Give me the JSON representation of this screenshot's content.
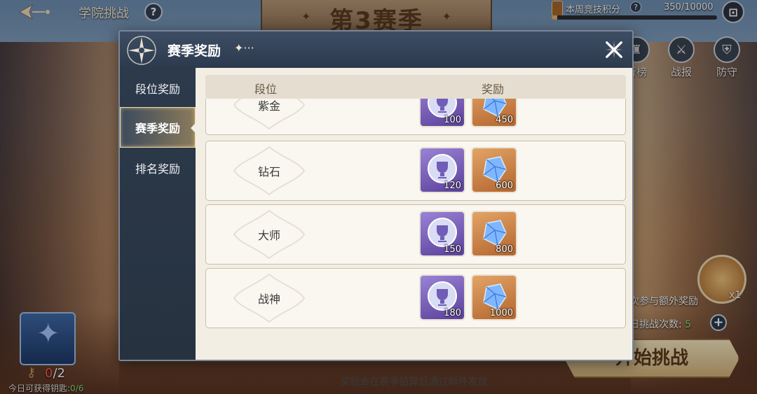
{
  "header": {
    "title": "学院挑战",
    "help": "?",
    "season_banner": "第3赛季",
    "weekly_points_label": "本周竞技积分",
    "weekly_points_help": "?",
    "weekly_points_value": "350/10000",
    "weekly_points_progress": 0.035,
    "gift_icon": "gift-box-icon"
  },
  "side_buttons": [
    {
      "label": "行榜",
      "icon": "leaderboard-icon"
    },
    {
      "label": "战报",
      "icon": "battle-report-icon"
    },
    {
      "label": "防守",
      "icon": "shield-icon"
    }
  ],
  "right_panel": {
    "extra_reward": "次参与额外奖励",
    "chest_count": "x1",
    "challenge_count_label": "日挑战次数:",
    "challenge_count_value": "5",
    "start_button": "开始挑战"
  },
  "key_panel": {
    "current": "0",
    "max": "/2",
    "today_label": "今日可获得钥匙:",
    "today_value": "0/6"
  },
  "modal": {
    "title": "赛季奖励",
    "title_dots": "✦···",
    "nav": [
      "段位奖励",
      "赛季奖励",
      "排名奖励"
    ],
    "active_nav": 1,
    "columns": {
      "tier": "段位",
      "reward": "奖励"
    },
    "rows": [
      {
        "tier": "紫金",
        "medal": "100",
        "gem": "450"
      },
      {
        "tier": "钻石",
        "medal": "120",
        "gem": "600"
      },
      {
        "tier": "大师",
        "medal": "150",
        "gem": "800"
      },
      {
        "tier": "战神",
        "medal": "180",
        "gem": "1000"
      }
    ],
    "footer_note": "奖励会在赛季结算后通过邮件发放"
  },
  "colors": {
    "medal_bg": "#7a62bb",
    "gem_bg": "#c9834a",
    "header_bg": "#33435a",
    "count_green": "#8ee27a",
    "key_red": "#ff5a5a"
  }
}
